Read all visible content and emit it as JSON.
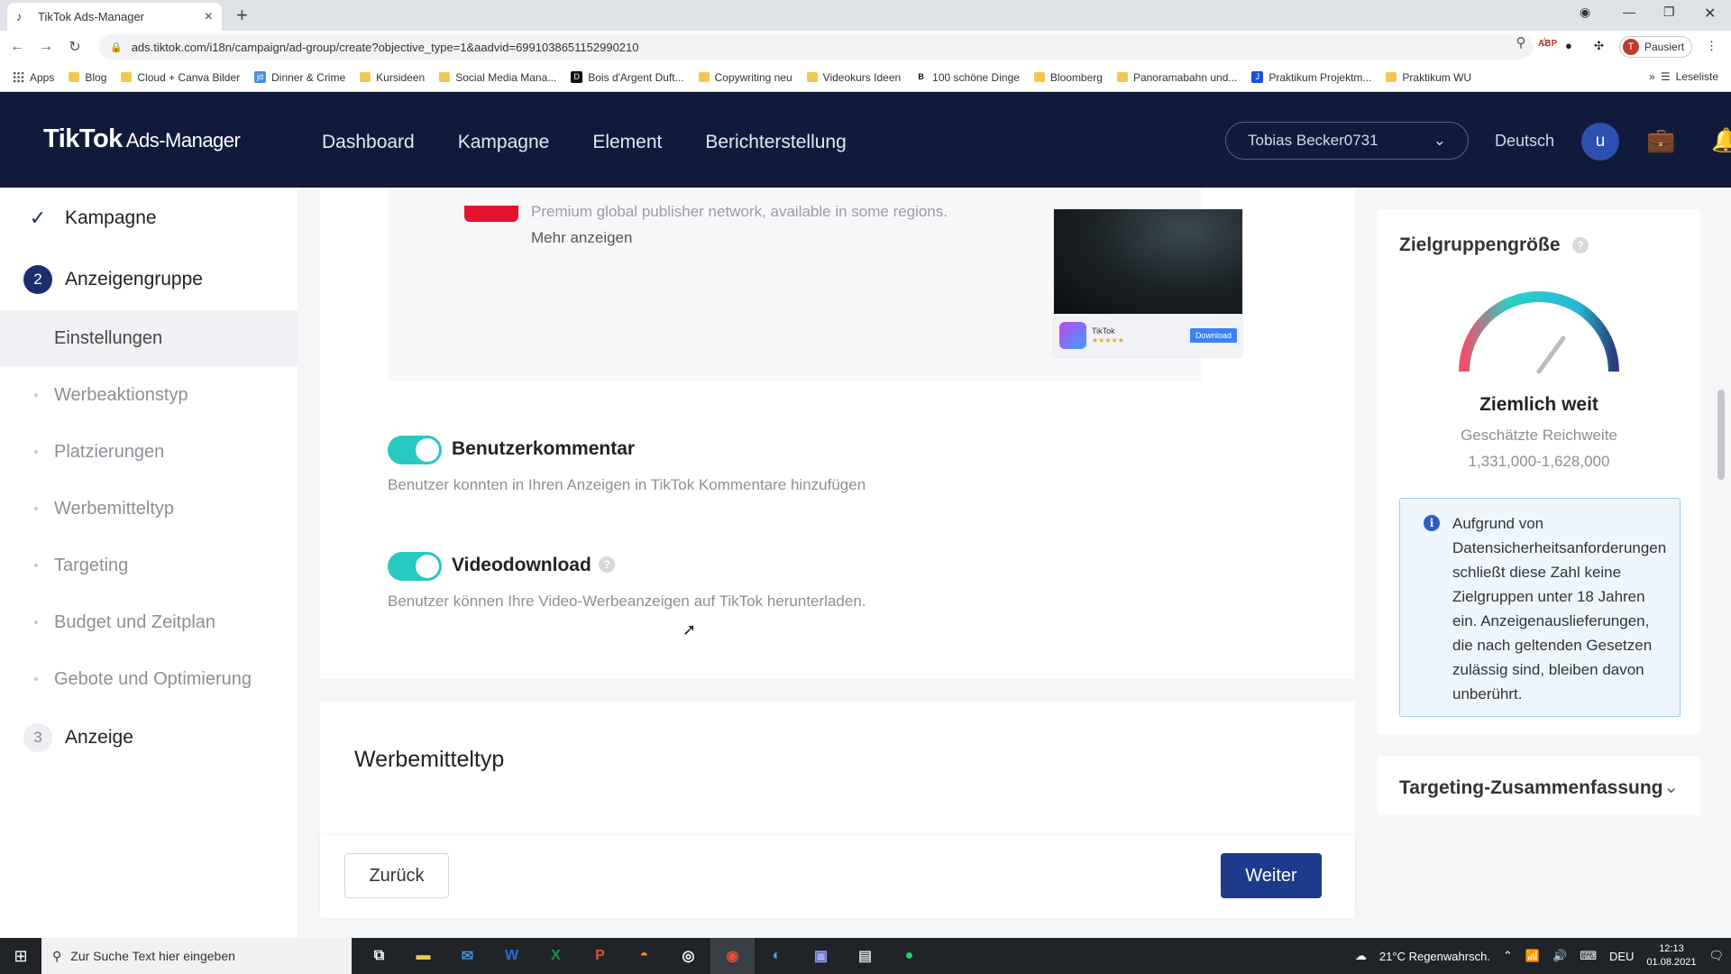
{
  "browser": {
    "tab_title": "TikTok Ads-Manager",
    "url": "ads.tiktok.com/i18n/campaign/ad-group/create?objective_type=1&aadvid=6991038651152990210",
    "profile_status": "Pausiert",
    "profile_initial": "T",
    "reading_list": "Leseliste",
    "bookmarks": [
      "Apps",
      "Blog",
      "Cloud + Canva Bilder",
      "Dinner & Crime",
      "Kursideen",
      "Social Media Mana...",
      "Bois d'Argent Duft...",
      "Copywriting neu",
      "Videokurs Ideen",
      "100 schöne Dinge",
      "Bloomberg",
      "Panoramabahn und...",
      "Praktikum Projektm...",
      "Praktikum WU"
    ]
  },
  "header": {
    "logo": "TikTok",
    "logo_sub": "Ads-Manager",
    "nav": [
      "Dashboard",
      "Kampagne",
      "Element",
      "Berichterstellung"
    ],
    "account": "Tobias Becker0731",
    "language": "Deutsch",
    "avatar_initial": "u"
  },
  "sidebar": {
    "step1": {
      "number": "✓",
      "label": "Kampagne"
    },
    "step2": {
      "number": "2",
      "label": "Anzeigengruppe"
    },
    "step3": {
      "number": "3",
      "label": "Anzeige"
    },
    "items": [
      "Einstellungen",
      "Werbeaktionstyp",
      "Platzierungen",
      "Werbemitteltyp",
      "Targeting",
      "Budget und Zeitplan",
      "Gebote und Optimierung"
    ]
  },
  "main": {
    "placement_desc": "Premium global publisher network, available in some regions.",
    "more_link": "Mehr anzeigen",
    "preview": {
      "app_name": "TikTok",
      "stars": "★★★★★",
      "download": "Download"
    },
    "comments": {
      "title": "Benutzerkommentar",
      "desc": "Benutzer konnten in Ihren Anzeigen in TikTok Kommentare hinzufügen",
      "enabled": true
    },
    "video_download": {
      "title": "Videodownload",
      "desc": "Benutzer können Ihre Video-Werbeanzeigen auf TikTok herunterladen.",
      "enabled": true
    },
    "section_title": "Werbemitteltyp",
    "back_button": "Zurück",
    "next_button": "Weiter"
  },
  "audience": {
    "title": "Zielgruppengröße",
    "gauge_label": "Ziemlich weit",
    "reach_label": "Geschätzte Reichweite",
    "reach_value": "1,331,000-1,628,000",
    "info": "Aufgrund von Datensicherheitsanforderungen schließt diese Zahl keine Zielgruppen unter 18 Jahren ein. Anzeigenauslieferungen, die nach geltenden Gesetzen zulässig sind, bleiben davon unberührt.",
    "summary": "Targeting-Zusammenfassung"
  },
  "taskbar": {
    "search_placeholder": "Zur Suche Text hier eingeben",
    "weather": "21°C Regenwahrsch.",
    "lang": "DEU",
    "time": "12:13",
    "date": "01.08.2021"
  },
  "colors": {
    "header_bg": "#101b3c",
    "toggle_on": "#27c9c0",
    "primary": "#1e3a8a"
  }
}
